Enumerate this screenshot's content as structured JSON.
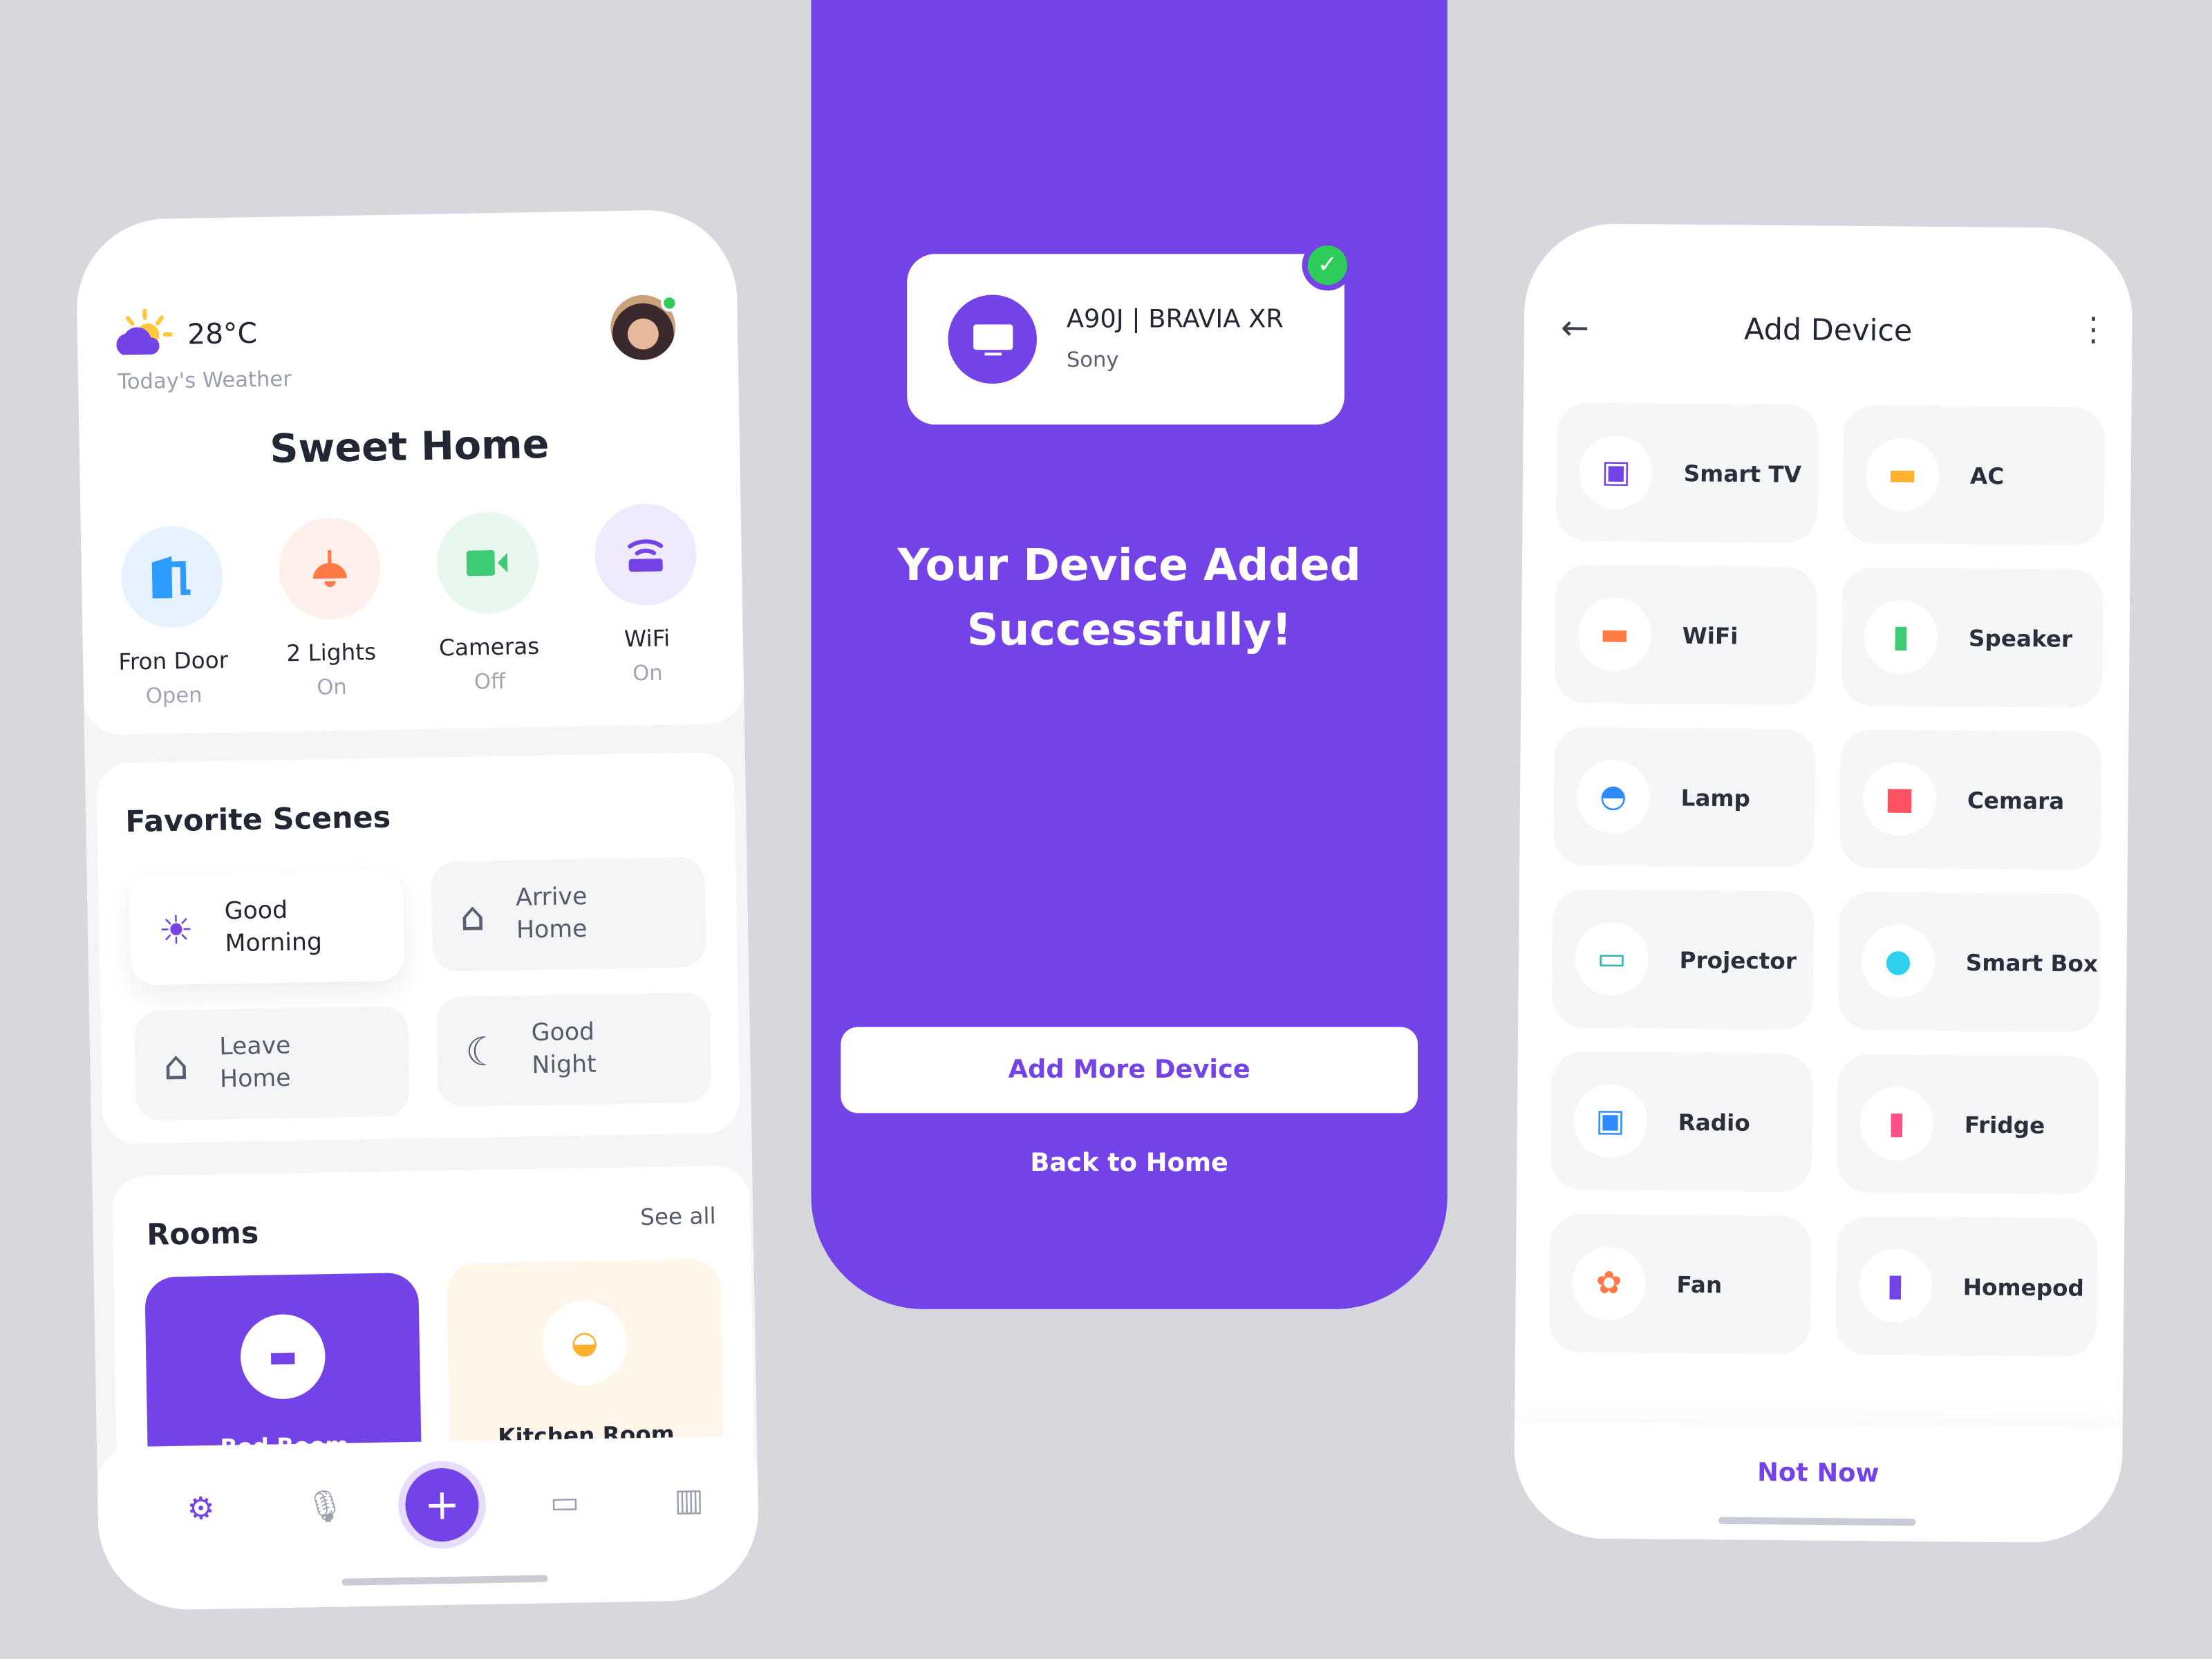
{
  "home": {
    "temperature": "28°C",
    "weather_label": "Today's Weather",
    "title": "Sweet Home",
    "quick": [
      {
        "label": "Fron Door",
        "status": "Open",
        "icon": "door-icon",
        "color": "#2e9bff",
        "bg": "#e6f3ff"
      },
      {
        "label": "2 Lights",
        "status": "On",
        "icon": "lamp-icon",
        "color": "#ff7a45",
        "bg": "#fff0eb"
      },
      {
        "label": "Cameras",
        "status": "Off",
        "icon": "video-camera-icon",
        "color": "#3ecb76",
        "bg": "#e8f8ee"
      },
      {
        "label": "WiFi",
        "status": "On",
        "icon": "wifi-router-icon",
        "color": "#7443e8",
        "bg": "#efeafd"
      }
    ],
    "scenes_title": "Favorite Scenes",
    "scenes": [
      {
        "line1": "Good",
        "line2": "Morning",
        "icon": "sun-house-icon"
      },
      {
        "line1": "Arrive",
        "line2": "Home",
        "icon": "arrive-home-icon"
      },
      {
        "line1": "Leave",
        "line2": "Home",
        "icon": "leave-home-icon"
      },
      {
        "line1": "Good",
        "line2": "Night",
        "icon": "moon-house-icon"
      }
    ],
    "rooms_title": "Rooms",
    "see_all": "See all",
    "rooms": [
      {
        "label": "Bed Room",
        "icon": "bed-icon"
      },
      {
        "label": "Kitchen Room",
        "icon": "bowl-icon"
      }
    ],
    "nav": [
      "toggle-icon",
      "microphone-icon",
      "plus-icon",
      "video-icon",
      "chart-icon"
    ]
  },
  "success": {
    "device_name": "A90J | BRAVIA XR",
    "brand": "Sony",
    "message_line1": "Your Device Added",
    "message_line2": "Successfully!",
    "add_more": "Add More Device",
    "back": "Back to Home"
  },
  "add_device": {
    "title": "Add Device",
    "not_now": "Not Now",
    "devices": [
      {
        "label": "Smart TV",
        "color": "#7443e8"
      },
      {
        "label": "AC",
        "color": "#ffb02e"
      },
      {
        "label": "WiFi",
        "color": "#ff7a45"
      },
      {
        "label": "Speaker",
        "color": "#3ecb76"
      },
      {
        "label": "Lamp",
        "color": "#2e8bff"
      },
      {
        "label": "Cemara",
        "color": "#ff5160"
      },
      {
        "label": "Projector",
        "color": "#2fb5b5"
      },
      {
        "label": "Smart Box",
        "color": "#2ed1f0"
      },
      {
        "label": "Radio",
        "color": "#2e8bff"
      },
      {
        "label": "Fridge",
        "color": "#ff4f8b"
      },
      {
        "label": "Fan",
        "color": "#ff7a45"
      },
      {
        "label": "Homepod",
        "color": "#7443e8"
      }
    ]
  },
  "colors": {
    "accent": "#7443e8",
    "background": "#d6d8dd"
  }
}
